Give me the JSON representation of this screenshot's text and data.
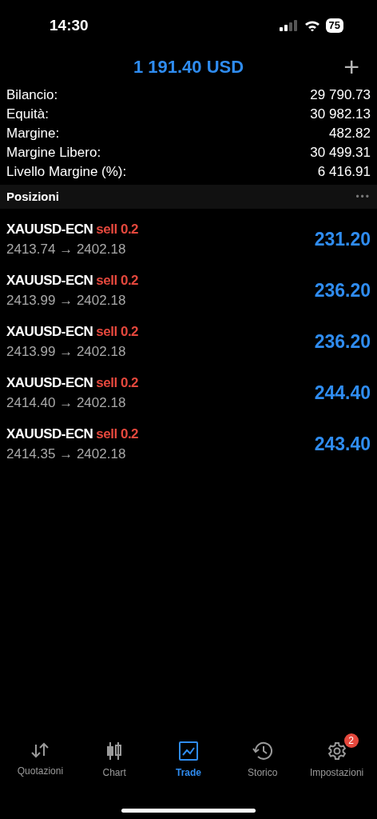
{
  "status_bar": {
    "time": "14:30",
    "battery": "75"
  },
  "header": {
    "title": "1 191.40 USD",
    "add": "+"
  },
  "summary": [
    {
      "label": "Bilancio:",
      "value": "29 790.73"
    },
    {
      "label": "Equità:",
      "value": "30 982.13"
    },
    {
      "label": "Margine:",
      "value": "482.82"
    },
    {
      "label": "Margine Libero:",
      "value": "30 499.31"
    },
    {
      "label": "Livello Margine (%):",
      "value": "6 416.91"
    }
  ],
  "section": {
    "title": "Posizioni",
    "more": "•••"
  },
  "positions": [
    {
      "symbol": "XAUUSD-ECN",
      "order": "sell 0.2",
      "prices": "2413.74 → 2402.18",
      "profit": "231.20"
    },
    {
      "symbol": "XAUUSD-ECN",
      "order": "sell 0.2",
      "prices": "2413.99 → 2402.18",
      "profit": "236.20"
    },
    {
      "symbol": "XAUUSD-ECN",
      "order": "sell 0.2",
      "prices": "2413.99 → 2402.18",
      "profit": "236.20"
    },
    {
      "symbol": "XAUUSD-ECN",
      "order": "sell 0.2",
      "prices": "2414.40 → 2402.18",
      "profit": "244.40"
    },
    {
      "symbol": "XAUUSD-ECN",
      "order": "sell 0.2",
      "prices": "2414.35 → 2402.18",
      "profit": "243.40"
    }
  ],
  "tabs": [
    {
      "kind": "quotes",
      "label": "Quotazioni",
      "selected": false
    },
    {
      "kind": "chart",
      "label": "Chart",
      "selected": false
    },
    {
      "kind": "trade",
      "label": "Trade",
      "selected": true
    },
    {
      "kind": "history",
      "label": "Storico",
      "selected": false
    },
    {
      "kind": "settings",
      "label": "Impostazioni",
      "selected": false,
      "badge": "2"
    }
  ]
}
